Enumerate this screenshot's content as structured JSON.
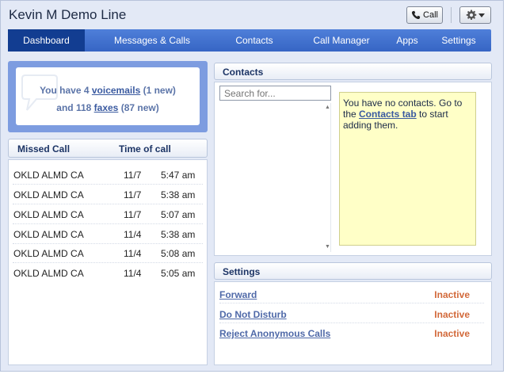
{
  "header": {
    "title": "Kevin M Demo Line",
    "call_label": "Call"
  },
  "nav": {
    "items": [
      {
        "label": "Dashboard",
        "active": true
      },
      {
        "label": "Messages & Calls"
      },
      {
        "label": "Contacts"
      },
      {
        "label": "Call Manager"
      },
      {
        "label": "Apps"
      },
      {
        "label": "Settings"
      }
    ]
  },
  "summary": {
    "line1_prefix": "You have 4 ",
    "line1_link": "voicemails",
    "line1_suffix": " (1 new)",
    "line2_prefix": "and 118 ",
    "line2_link": "faxes",
    "line2_suffix": " (87 new)"
  },
  "missed_calls": {
    "col_caller": "Missed Call",
    "col_time": "Time of call",
    "rows": [
      {
        "caller": "OKLD ALMD CA",
        "date": "11/7",
        "time": "5:47 am"
      },
      {
        "caller": "OKLD ALMD CA",
        "date": "11/7",
        "time": "5:38 am"
      },
      {
        "caller": "OKLD ALMD CA",
        "date": "11/7",
        "time": "5:07 am"
      },
      {
        "caller": "OKLD ALMD CA",
        "date": "11/4",
        "time": "5:38 am"
      },
      {
        "caller": "OKLD ALMD CA",
        "date": "11/4",
        "time": "5:08 am"
      },
      {
        "caller": "OKLD ALMD CA",
        "date": "11/4",
        "time": "5:05 am"
      }
    ]
  },
  "contacts": {
    "title": "Contacts",
    "search_placeholder": "Search for...",
    "empty_prefix": "You have no contacts. Go to the ",
    "empty_link": "Contacts tab",
    "empty_suffix": " to start adding them."
  },
  "settings": {
    "title": "Settings",
    "items": [
      {
        "label": "Forward",
        "status": "Inactive"
      },
      {
        "label": "Do Not Disturb",
        "status": "Inactive"
      },
      {
        "label": "Reject Anonymous Calls",
        "status": "Inactive"
      }
    ]
  },
  "colors": {
    "nav_bg": "#3f6fcf",
    "nav_active": "#123d91",
    "summary_bg": "#7d9ce0",
    "inactive_status": "#d2693a",
    "link": "#3a5aa0"
  }
}
